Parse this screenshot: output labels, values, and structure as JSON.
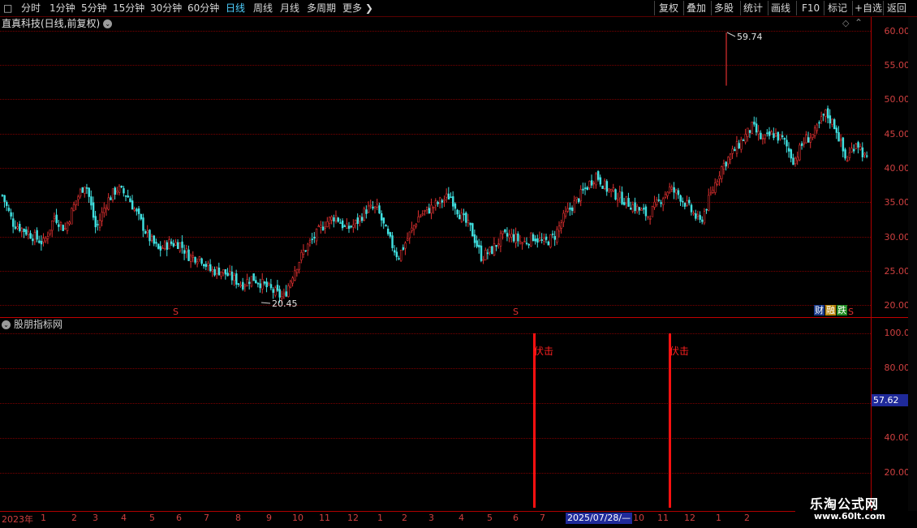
{
  "toolbar": {
    "left": [
      "分时",
      "1分钟",
      "5分钟",
      "15分钟",
      "30分钟",
      "60分钟",
      "日线",
      "周线",
      "月线",
      "多周期",
      "更多"
    ],
    "right": [
      "复权",
      "叠加",
      "多股",
      "统计",
      "画线",
      "F10",
      "标记",
      "+自选",
      "返回"
    ],
    "active": "日线"
  },
  "chart": {
    "title": "直真科技(日线,前复权)",
    "high_label": "59.74",
    "low_label": "20.45",
    "s_markers": [
      "S",
      "S",
      "S"
    ],
    "badges": [
      "财",
      "融",
      "跌"
    ],
    "price_ticks": [
      "60.00",
      "55.00",
      "50.00",
      "45.00",
      "40.00",
      "35.00",
      "30.00",
      "25.00",
      "20.00"
    ],
    "colors": {
      "up": "#e03030",
      "down": "#40e0e0",
      "grid": "#7a0000",
      "axis": "#d04040"
    }
  },
  "indicator": {
    "title": "股朋指标网",
    "ticks": [
      "100.0",
      "80.00",
      "57.62",
      "40.00",
      "20.00"
    ],
    "current_value": "57.62",
    "signals": [
      "伏击",
      "伏击"
    ]
  },
  "timeline": {
    "labels": [
      "2023年",
      "1",
      "2",
      "3",
      "4",
      "5",
      "6",
      "7",
      "8",
      "9",
      "10",
      "11",
      "12",
      "1",
      "2",
      "3",
      "4",
      "5",
      "6",
      "7",
      "10",
      "11",
      "12",
      "1",
      "2"
    ],
    "selected_date": "2025/07/28/—"
  },
  "watermark": {
    "line1": "乐淘公式网",
    "line2": "www.60lt.com"
  },
  "chart_data": {
    "type": "candlestick",
    "title": "直真科技(日线,前复权)",
    "ylim": [
      20,
      60
    ],
    "y_ticks": [
      20,
      25,
      30,
      35,
      40,
      45,
      50,
      55,
      60
    ],
    "annotations": [
      {
        "label": "59.74",
        "value": 59.74
      },
      {
        "label": "20.45",
        "value": 20.45
      }
    ],
    "close_path": [
      36,
      32,
      31,
      30,
      29,
      33,
      31,
      35,
      38,
      31,
      35,
      37,
      36,
      33,
      30,
      28,
      29,
      29,
      27,
      27,
      25,
      25,
      24,
      23,
      24,
      23,
      22,
      21,
      25,
      28,
      30,
      32,
      33,
      31,
      32,
      34,
      34,
      30,
      27,
      30,
      33,
      34,
      35,
      36,
      33,
      31,
      27,
      28,
      30,
      30,
      29,
      30,
      29,
      30,
      33,
      35,
      37,
      39,
      37,
      36,
      35,
      34,
      33,
      35,
      37,
      36,
      34,
      32,
      36,
      40,
      42,
      44,
      46,
      44,
      45,
      44,
      41,
      44,
      45,
      48,
      46,
      41,
      44,
      41
    ]
  }
}
